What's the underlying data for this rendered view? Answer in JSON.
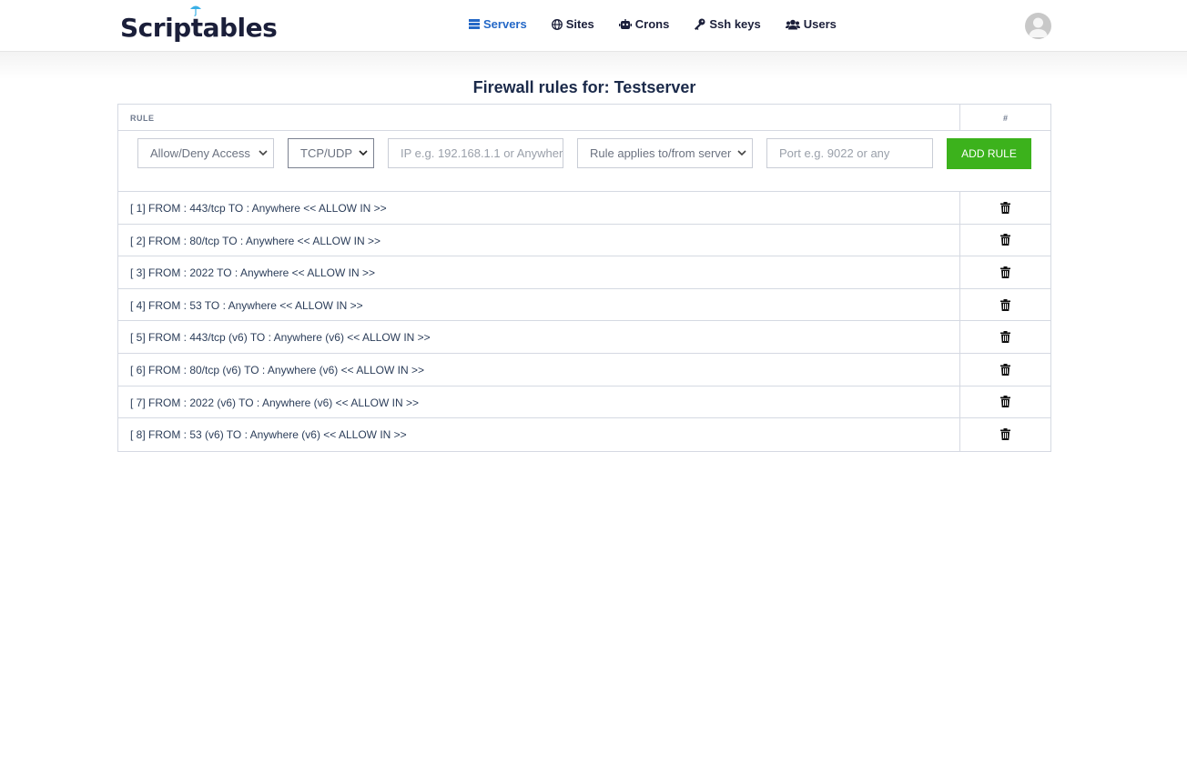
{
  "brand": {
    "name": "Scriptables"
  },
  "nav": [
    {
      "label": "Servers",
      "icon": "server-icon",
      "active": true
    },
    {
      "label": "Sites",
      "icon": "globe-icon",
      "active": false
    },
    {
      "label": "Crons",
      "icon": "robot-icon",
      "active": false
    },
    {
      "label": "Ssh keys",
      "icon": "key-icon",
      "active": false
    },
    {
      "label": "Users",
      "icon": "users-icon",
      "active": false
    }
  ],
  "page": {
    "title": "Firewall rules for: Testserver"
  },
  "table": {
    "col_rule": "RULE",
    "col_hash": "#",
    "form": {
      "access_select": "Allow/Deny Access",
      "protocol_select": "TCP/UDP",
      "ip_placeholder": "IP e.g. 192.168.1.1 or Anywhere",
      "direction_select": "Rule applies to/from server",
      "port_placeholder": "Port e.g. 9022 or any",
      "add_button": "ADD RULE"
    },
    "rows": [
      "[ 1] FROM : 443/tcp TO : Anywhere << ALLOW IN >>",
      "[ 2] FROM : 80/tcp TO : Anywhere << ALLOW IN >>",
      "[ 3] FROM : 2022 TO : Anywhere << ALLOW IN >>",
      "[ 4] FROM : 53 TO : Anywhere << ALLOW IN >>",
      "[ 5] FROM : 443/tcp (v6) TO : Anywhere (v6) << ALLOW IN >>",
      "[ 6] FROM : 80/tcp (v6) TO : Anywhere (v6) << ALLOW IN >>",
      "[ 7] FROM : 2022 (v6) TO : Anywhere (v6) << ALLOW IN >>",
      "[ 8] FROM : 53 (v6) TO : Anywhere (v6) << ALLOW IN >>"
    ]
  },
  "colors": {
    "accent": "#2468c7",
    "add_button": "#3cb21c",
    "title": "#1b2a4a"
  }
}
